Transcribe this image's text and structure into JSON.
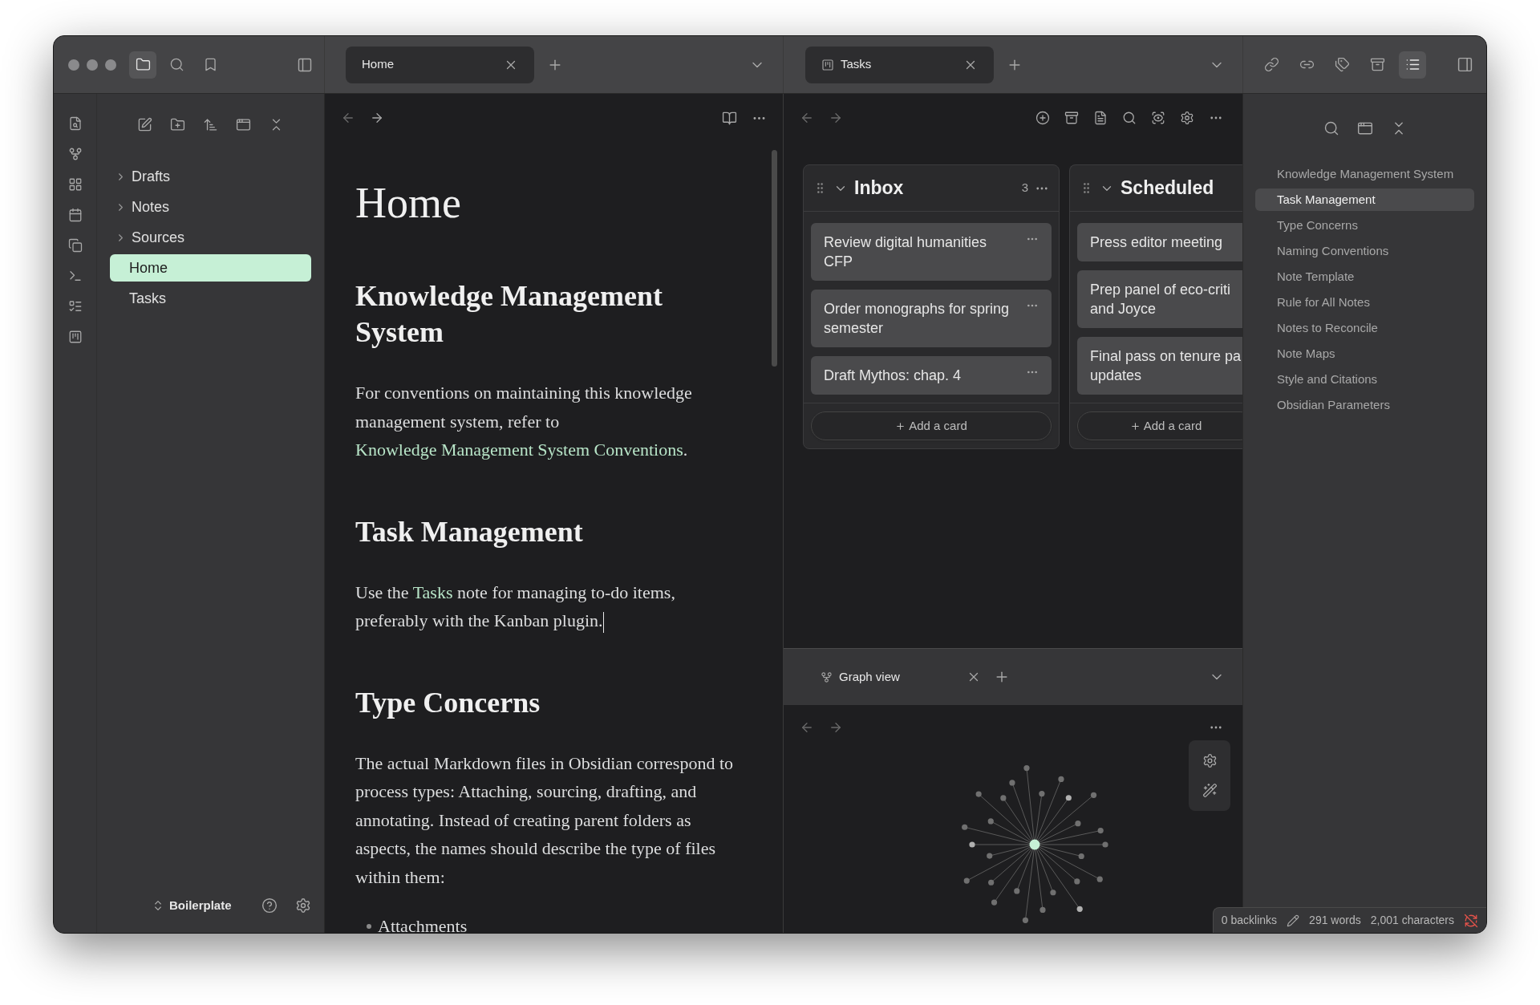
{
  "title_bar": {
    "left_tabs": [
      {
        "kind": "files",
        "selected": true
      },
      {
        "kind": "search",
        "selected": false
      },
      {
        "kind": "bookmarks",
        "selected": false
      }
    ],
    "right_tabs": [
      {
        "kind": "backlinks",
        "selected": false
      },
      {
        "kind": "outgoing",
        "selected": false
      },
      {
        "kind": "tags",
        "selected": false
      },
      {
        "kind": "archive",
        "selected": false
      },
      {
        "kind": "outline",
        "selected": true
      }
    ]
  },
  "file_explorer": {
    "items": [
      {
        "label": "Drafts",
        "kind": "folder",
        "selected": false
      },
      {
        "label": "Notes",
        "kind": "folder",
        "selected": false
      },
      {
        "label": "Sources",
        "kind": "folder",
        "selected": false
      },
      {
        "label": "Home",
        "kind": "file",
        "selected": true
      },
      {
        "label": "Tasks",
        "kind": "file",
        "selected": false
      }
    ],
    "vault": "Boilerplate"
  },
  "editor": {
    "tab": {
      "title": "Home",
      "selected": true
    },
    "title": "Home",
    "blocks": [
      {
        "kind": "heading",
        "text": "Knowledge Management System"
      },
      {
        "kind": "paragraph",
        "cursor": false,
        "parts": [
          {
            "text": "For conventions on maintaining this knowledge management system, refer to ",
            "link": false
          },
          {
            "text": "Knowledge Management System Conventions",
            "link": true
          },
          {
            "text": ".",
            "link": false
          }
        ]
      },
      {
        "kind": "heading",
        "text": "Task Management"
      },
      {
        "kind": "paragraph",
        "cursor": true,
        "parts": [
          {
            "text": "Use the ",
            "link": false
          },
          {
            "text": "Tasks",
            "link": true
          },
          {
            "text": " note for managing to-do items, preferably with the Kanban plugin.",
            "link": false
          }
        ]
      },
      {
        "kind": "heading",
        "text": "Type Concerns"
      },
      {
        "kind": "paragraph",
        "cursor": false,
        "parts": [
          {
            "text": "The actual Markdown files in Obsidian correspond to process types: Attaching, sourcing, drafting, and annotating. Instead of creating parent folders as aspects, the names should describe the type of files within them:",
            "link": false
          }
        ]
      },
      {
        "kind": "bullet",
        "text": "Attachments"
      }
    ]
  },
  "tasks": {
    "tab": {
      "title": "Tasks",
      "selected": true
    },
    "lanes": [
      {
        "title": "Inbox",
        "count": "3",
        "cards": [
          {
            "text": "Review digital humanities CFP",
            "menu": true
          },
          {
            "text": "Order monographs for spring semester",
            "menu": true
          },
          {
            "text": "Draft Mythos: chap. 4",
            "menu": true
          }
        ],
        "add_label": "Add a card"
      },
      {
        "title": "Scheduled",
        "cards": [
          {
            "text": "Press editor meeting",
            "menu": false
          },
          {
            "text": "Prep panel of eco-criti\nand Joyce",
            "menu": false
          },
          {
            "text": "Final pass on tenure pa\nupdates",
            "menu": false
          }
        ],
        "add_label": "Add a card"
      }
    ]
  },
  "graph": {
    "tab": {
      "title": "Graph view",
      "selected": false
    }
  },
  "outline": {
    "items": [
      {
        "label": "Knowledge Management System",
        "selected": false
      },
      {
        "label": "Task Management",
        "selected": true
      },
      {
        "label": "Type Concerns",
        "selected": false
      },
      {
        "label": "Naming Conventions",
        "selected": false
      },
      {
        "label": "Note Template",
        "selected": false
      },
      {
        "label": "Rule for All Notes",
        "selected": false
      },
      {
        "label": "Notes to Reconcile",
        "selected": false
      },
      {
        "label": "Note Maps",
        "selected": false
      },
      {
        "label": "Style and Citations",
        "selected": false
      },
      {
        "label": "Obsidian Parameters",
        "selected": false
      }
    ]
  },
  "status_bar": {
    "backlinks": "0 backlinks",
    "words": "291 words",
    "characters": "2,001 characters"
  }
}
